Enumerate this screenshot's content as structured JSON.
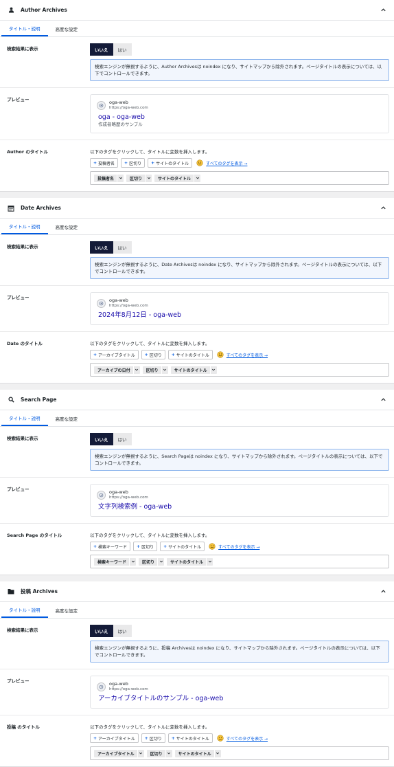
{
  "common": {
    "tab_title": "タイトル・説明",
    "tab_advanced": "高度な設定",
    "label_noindex": "検索結果に表示",
    "toggle_no": "いいえ",
    "toggle_yes": "はい",
    "label_preview": "プレビュー",
    "help_text": "以下のタグをクリックして、タイトルに変数を挿入します。",
    "show_all_tags": "すべてのタグを表示 →",
    "preview_site": "oga-web",
    "preview_url": "https://oga-web.com"
  },
  "sections": [
    {
      "title": "Author Archives",
      "icon": "person-icon",
      "notice": "検索エンジンが無視するように、Author Archivesは noindex になり、サイトマップから除外されます。ページタイトルの表示については、以下でコントロールできます。",
      "preview_title": "oga - oga-web",
      "preview_desc": "作成者略歴のサンプル",
      "title_label": "Author のタイトル",
      "tag_buttons": [
        "投稿者名",
        "区切り",
        "サイトのタイトル"
      ],
      "chips": [
        "投稿者名",
        "区切り",
        "サイトのタイトル"
      ]
    },
    {
      "title": "Date Archives",
      "icon": "calendar-icon",
      "notice": "検索エンジンが無視するように、Date Archivesは noindex になり、サイトマップから除外されます。ページタイトルの表示については、以下でコントロールできます。",
      "preview_title": "2024年8月12日 - oga-web",
      "preview_desc": "",
      "title_label": "Date のタイトル",
      "tag_buttons": [
        "アーカイブタイトル",
        "区切り",
        "サイトのタイトル"
      ],
      "chips": [
        "アーカイブの日付",
        "区切り",
        "サイトのタイトル"
      ]
    },
    {
      "title": "Search Page",
      "icon": "search-icon",
      "notice": "検索エンジンが無視するように、Search Pageは noindex になり、サイトマップから除外されます。ページタイトルの表示については、以下でコントロールできます。",
      "preview_title": "文字列検索例 - oga-web",
      "preview_desc": "",
      "title_label": "Search Page のタイトル",
      "tag_buttons": [
        "検索キーワード",
        "区切り",
        "サイトのタイトル"
      ],
      "chips": [
        "検索キーワード",
        "区切り",
        "サイトのタイトル"
      ]
    },
    {
      "title": "投稿 Archives",
      "icon": "folder-icon",
      "notice": "検索エンジンが無視するように、投稿 Archivesは noindex になり、サイトマップから除外されます。ページタイトルの表示については、以下でコントロールできます。",
      "preview_title": "アーカイブタイトルのサンプル - oga-web",
      "preview_desc": "",
      "title_label": "投稿 のタイトル",
      "tag_buttons": [
        "アーカイブタイトル",
        "区切り",
        "サイトのタイトル"
      ],
      "chips": [
        "アーカイブタイトル",
        "区切り",
        "サイトのタイトル"
      ]
    }
  ]
}
